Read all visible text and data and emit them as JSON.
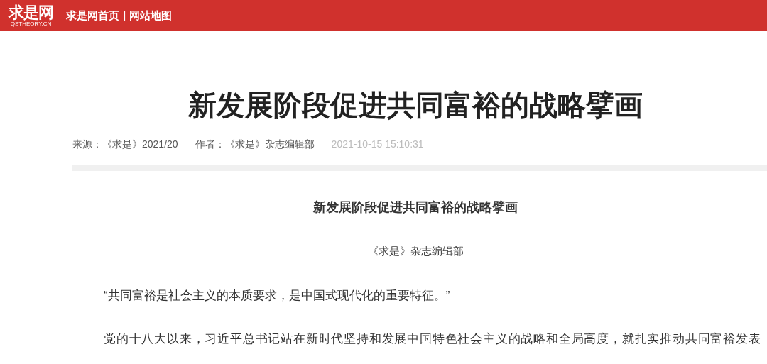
{
  "header": {
    "logo": {
      "mark": "求是网",
      "domain": "QSTHEORY.CN"
    },
    "nav": [
      "求是网首页",
      "网站地图"
    ],
    "separator": "|"
  },
  "article": {
    "title": "新发展阶段促进共同富裕的战略擘画",
    "meta": [
      {
        "label": "来源：",
        "value": "《求是》2021/20"
      },
      {
        "label": "作者：",
        "value": "《求是》杂志编辑部"
      }
    ],
    "date": "2021-10-15 15:10:31",
    "subtitle": "新发展阶段促进共同富裕的战略擘画",
    "byline": "《求是》杂志编辑部",
    "paragraphs": [
      "“共同富裕是社会主义的本质要求，是中国式现代化的重要特征。”",
      "党的十八大以来，习近平总书记站在新时代坚持和发展中国特色社会主义的战略和全局高度，就扎实推动共同富裕发表"
    ]
  }
}
